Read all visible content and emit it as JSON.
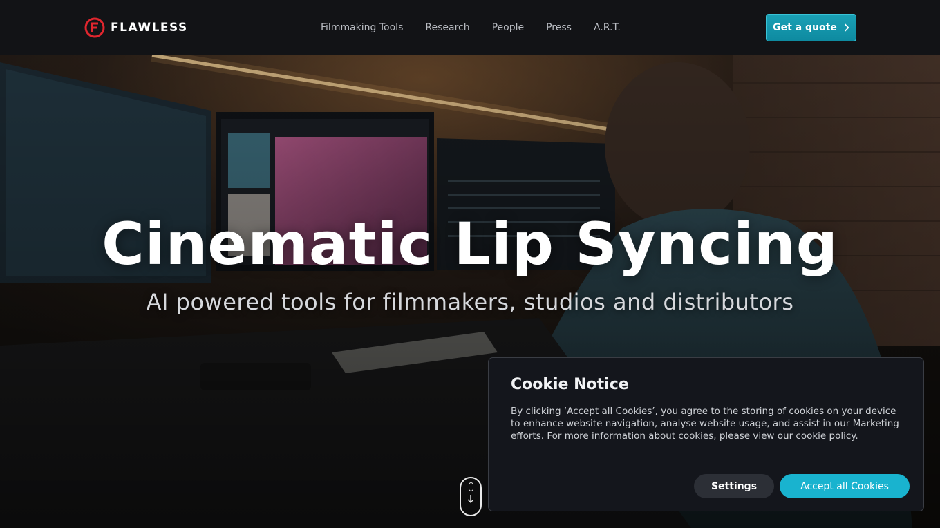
{
  "header": {
    "brand": "FLAWLESS",
    "nav": [
      {
        "label": "Filmmaking Tools"
      },
      {
        "label": "Research"
      },
      {
        "label": "People"
      },
      {
        "label": "Press"
      },
      {
        "label": "A.R.T."
      }
    ],
    "cta_label": "Get a quote",
    "icons": {
      "logo": "flawless-f-logo",
      "cta": "chevron-right-icon"
    }
  },
  "hero": {
    "title": "Cinematic Lip Syncing",
    "subtitle": "AI powered tools for filmmakers, studios and distributors",
    "background": "photo of a person editing video at a multi-monitor workstation",
    "scroll_icon": "mouse-scroll-down-icon"
  },
  "cookie_notice": {
    "title": "Cookie Notice",
    "body": "By clicking ‘Accept all Cookies’, you agree to the storing of cookies on your device to enhance website navigation, analyse website usage, and assist in our Marketing efforts. For more information about cookies, please view our cookie policy.",
    "settings_label": "Settings",
    "accept_label": "Accept all Cookies"
  },
  "colors": {
    "accent": "#19b3cf",
    "logo_red": "#e0262e",
    "topbar_bg": "#121316",
    "cookie_bg": "#14161c"
  }
}
